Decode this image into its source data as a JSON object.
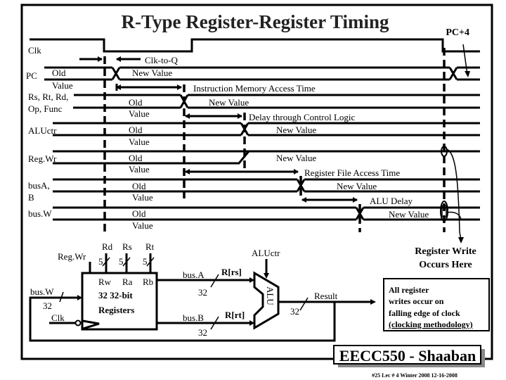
{
  "title": "R-Type Register-Register Timing",
  "pc_plus4_label": "PC+4",
  "signals": {
    "clk": "Clk",
    "pc": "PC",
    "rs_line1": "Rs, Rt, Rd,",
    "rs_line2": "Op, Func",
    "aluctr": "ALUctr",
    "regwr": "Reg.Wr",
    "busab_line1": "busA,",
    "busab_line2": "B",
    "busw": "bus.W"
  },
  "values": {
    "old": "Old",
    "value": "Value",
    "new_value": "New Value"
  },
  "delays": {
    "clk_to_q": "Clk-to-Q",
    "imem": "Instruction Memory Access Time",
    "control": "Delay through Control Logic",
    "regfile": "Register File Access Time",
    "alu": "ALU Delay"
  },
  "register_write_line1": "Register Write",
  "register_write_line2": "Occurs Here",
  "datapath": {
    "regwr": "Reg.Wr",
    "rd": "Rd",
    "rs": "Rs",
    "rt": "Rt",
    "five": "5",
    "busw": "bus.W",
    "thirtytwo": "32",
    "clk": "Clk",
    "rw": "Rw",
    "ra": "Ra",
    "rb": "Rb",
    "regfile_line1": "32 32-bit",
    "regfile_line2": "Registers",
    "busa": "bus.A",
    "busb": "bus.B",
    "rrs": "R[rs]",
    "rrt": "R[rt]",
    "aluctr": "ALUctr",
    "alu": "ALU",
    "result": "Result"
  },
  "note": {
    "line1": "All register",
    "line2": "writes occur on",
    "line3": "falling edge of clock",
    "line4": "(clocking methodology)"
  },
  "footer": {
    "brand": "EECC550 - Shaaban",
    "info": "#25   Lec # 4   Winter 2008   12-16-2008"
  }
}
